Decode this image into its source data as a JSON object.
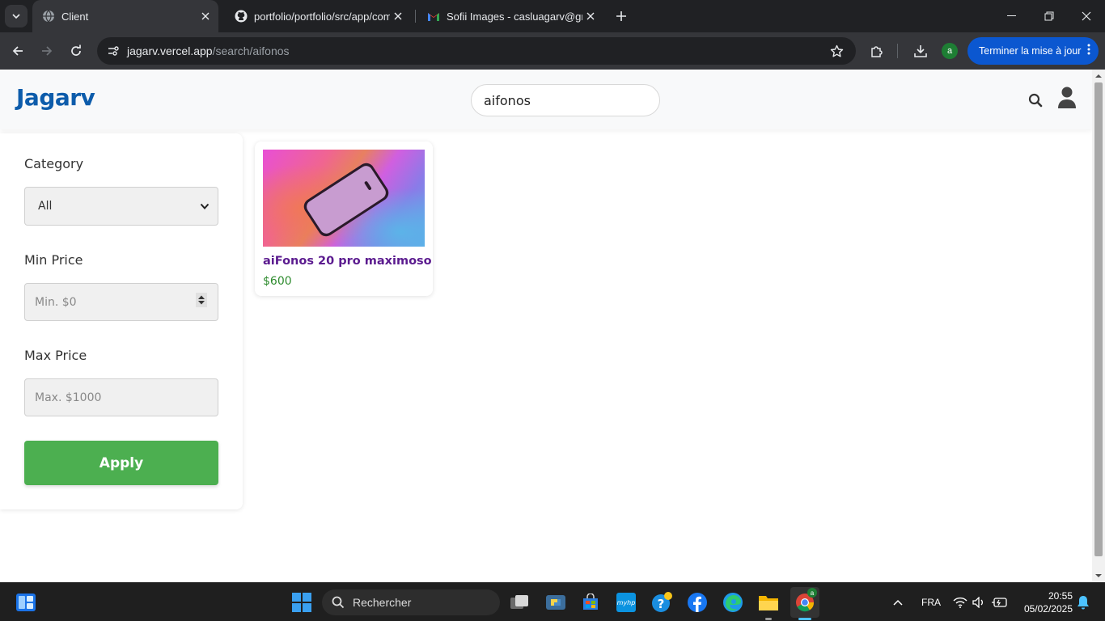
{
  "browser": {
    "tabs": [
      {
        "title": "Client",
        "active": true,
        "favicon": "globe-icon"
      },
      {
        "title": "portfolio/portfolio/src/app/com",
        "active": false,
        "favicon": "github-icon"
      },
      {
        "title": "Sofii Images - casluagarv@gma",
        "active": false,
        "favicon": "gmail-icon"
      }
    ],
    "url_host": "jagarv.vercel.app",
    "url_path": "/search/aifonos",
    "profile_initial": "a",
    "update_button": "Terminer la mise à jour"
  },
  "header": {
    "logo": "Jagarv",
    "search_value": "aifonos"
  },
  "filters": {
    "category_label": "Category",
    "category_selected": "All",
    "min_price_label": "Min Price",
    "min_price_placeholder": "Min. $0",
    "max_price_label": "Max Price",
    "max_price_placeholder": "Max. $1000",
    "apply_label": "Apply"
  },
  "products": [
    {
      "name": "aiFonos 20 pro maximoso",
      "price": "$600"
    }
  ],
  "taskbar": {
    "search_placeholder": "Rechercher",
    "language": "FRA",
    "time": "20:55",
    "date": "05/02/2025"
  },
  "colors": {
    "logo": "#0d5cab",
    "apply": "#4caf50",
    "product_name": "#5b1b8f",
    "price": "#2e8b2e",
    "chrome_dark": "#202124",
    "update_button": "#0b57d0"
  }
}
